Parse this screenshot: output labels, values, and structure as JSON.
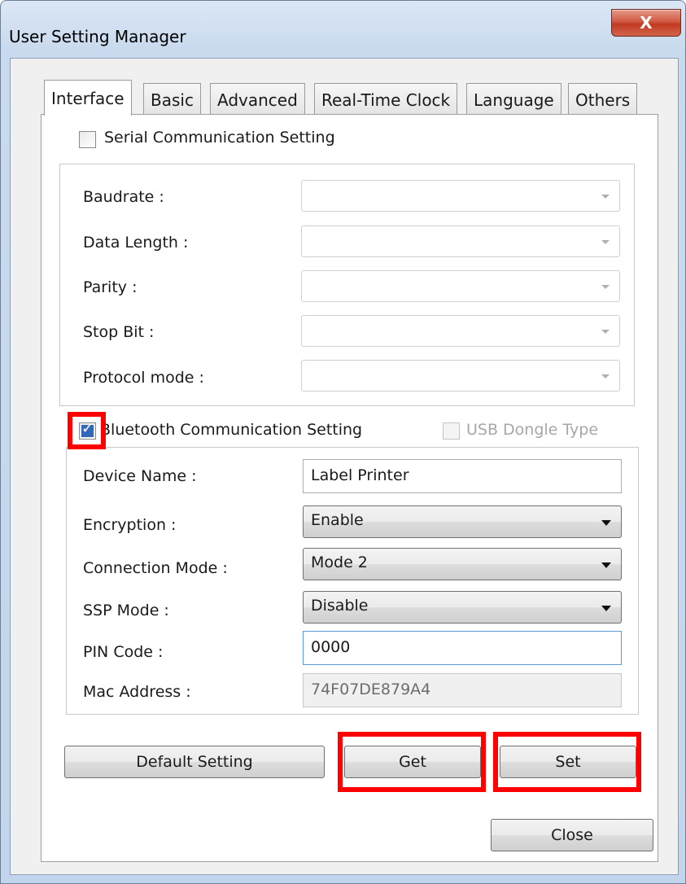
{
  "window": {
    "title": "User Setting Manager",
    "close_glyph": "X"
  },
  "tabs": [
    {
      "label": "Interface"
    },
    {
      "label": "Basic"
    },
    {
      "label": "Advanced"
    },
    {
      "label": "Real-Time Clock"
    },
    {
      "label": "Language"
    },
    {
      "label": "Others"
    }
  ],
  "serial": {
    "checkbox_label": "Serial Communication Setting",
    "checked": false,
    "fields": [
      {
        "label": "Baudrate :",
        "value": ""
      },
      {
        "label": "Data Length :",
        "value": ""
      },
      {
        "label": "Parity :",
        "value": ""
      },
      {
        "label": "Stop Bit :",
        "value": ""
      },
      {
        "label": "Protocol mode :",
        "value": ""
      }
    ]
  },
  "bluetooth": {
    "checkbox_label": "Bluetooth Communication Setting",
    "checked": true,
    "usb_dongle_label": "USB Dongle Type",
    "usb_dongle_checked": false,
    "device_name_label": "Device Name :",
    "device_name_value": "Label Printer",
    "encryption_label": "Encryption :",
    "encryption_value": "Enable",
    "connection_mode_label": "Connection Mode :",
    "connection_mode_value": "Mode 2",
    "ssp_mode_label": "SSP Mode :",
    "ssp_mode_value": "Disable",
    "pin_code_label": "PIN Code :",
    "pin_code_value": "0000",
    "mac_address_label": "Mac Address :",
    "mac_address_value": "74F07DE879A4"
  },
  "buttons": {
    "default_setting": "Default Setting",
    "get": "Get",
    "set": "Set",
    "close": "Close"
  },
  "colors": {
    "highlight": "#ff0000",
    "checkbox_checked": "#3567b9"
  }
}
